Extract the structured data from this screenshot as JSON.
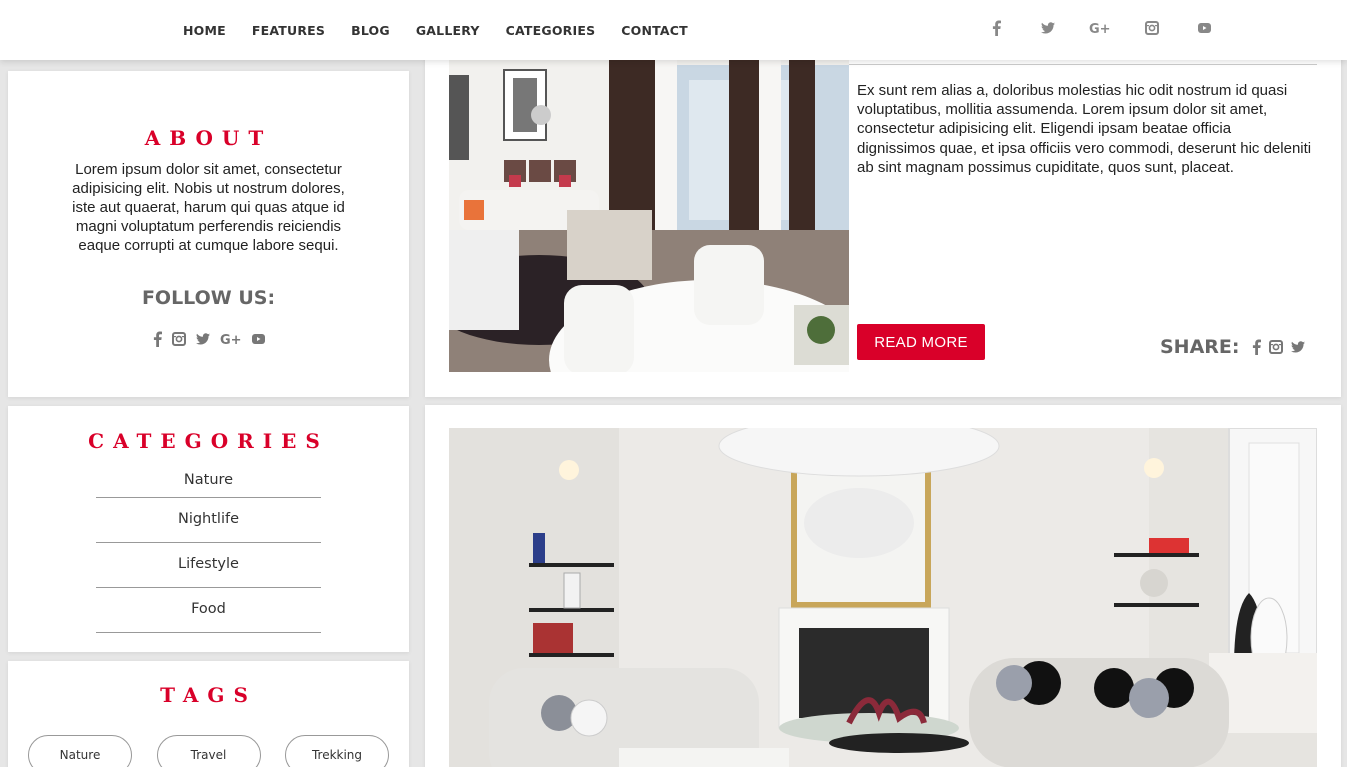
{
  "nav": {
    "items": [
      "HOME",
      "FEATURES",
      "BLOG",
      "GALLERY",
      "CATEGORIES",
      "CONTACT"
    ],
    "social_icons": [
      "facebook-icon",
      "twitter-icon",
      "google-plus-icon",
      "instagram-icon",
      "youtube-icon"
    ]
  },
  "about": {
    "title": "ABOUT",
    "text": "Lorem ipsum dolor sit amet, consectetur adipisicing elit. Nobis ut nostrum dolores, iste aut quaerat, harum qui quas atque id magni voluptatum perferendis reiciendis eaque corrupti at cumque labore sequi.",
    "follow_label": "FOLLOW US:",
    "social_icons": [
      "facebook-icon",
      "instagram-icon",
      "twitter-icon",
      "google-plus-icon",
      "youtube-icon"
    ]
  },
  "categories": {
    "title": "CATEGORIES",
    "items": [
      "Nature",
      "Nightlife",
      "Lifestyle",
      "Food"
    ]
  },
  "tags": {
    "title": "TAGS",
    "items": [
      "Nature",
      "Travel",
      "Trekking"
    ]
  },
  "post1": {
    "text": "Ex sunt rem alias a, doloribus molestias hic odit nostrum id quasi voluptatibus, mollitia assumenda. Lorem ipsum dolor sit amet, consectetur adipisicing elit. Eligendi ipsam beatae officia dignissimos quae, et ipsa officiis vero commodi, deserunt hic deleniti ab sint magnam possimus cupiditate, quos sunt, placeat.",
    "read_more": "READ MORE",
    "share_label": "SHARE:",
    "share_icons": [
      "facebook-icon",
      "instagram-icon",
      "twitter-icon"
    ]
  },
  "colors": {
    "accent": "#d90029",
    "text": "#222222",
    "muted": "#666666"
  }
}
